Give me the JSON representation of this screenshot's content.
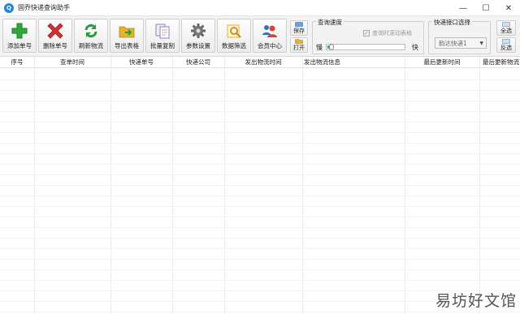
{
  "window": {
    "title": "固乔快递查询助手",
    "controls": {
      "minimize": "—",
      "maximize": "☐",
      "close": "✕"
    }
  },
  "toolbar": {
    "buttons": [
      {
        "label": "添加单号",
        "icon": "plus-icon",
        "color": "#2fa83a"
      },
      {
        "label": "删除单号",
        "icon": "x-icon",
        "color": "#d33030"
      },
      {
        "label": "刷新物流",
        "icon": "refresh-icon",
        "color": "#2f9a3c"
      },
      {
        "label": "导出表格",
        "icon": "export-folder-icon",
        "color": "#e4b42a"
      },
      {
        "label": "批量复制",
        "icon": "copy-icon",
        "color": "#9a7bbf"
      },
      {
        "label": "参数设置",
        "icon": "gear-icon",
        "color": "#666666"
      },
      {
        "label": "数据筛选",
        "icon": "search-filter-icon",
        "color": "#e8b028"
      },
      {
        "label": "会员中心",
        "icon": "members-icon",
        "color": "#d0473c"
      }
    ],
    "save_label": "保存",
    "open_label": "打开",
    "select_all_label": "全选",
    "invert_label": "反选"
  },
  "speed_group": {
    "title": "查询速度",
    "checkbox_label": "查询时滚动表格",
    "checked": true,
    "slow_label": "慢",
    "fast_label": "快",
    "slider_value": 0.03
  },
  "api_group": {
    "title": "快递接口选择",
    "selected": "韵达快递1"
  },
  "table": {
    "columns": [
      "序号",
      "查单时间",
      "快递单号",
      "快递公司",
      "发出物流时间",
      "发出物流信息",
      "最后更新时间",
      "最后更新物流"
    ],
    "rows": []
  },
  "watermark": {
    "text": "易坊好文馆"
  },
  "colors": {
    "accent": "#27b3a6",
    "brand": "#1e88d6"
  }
}
